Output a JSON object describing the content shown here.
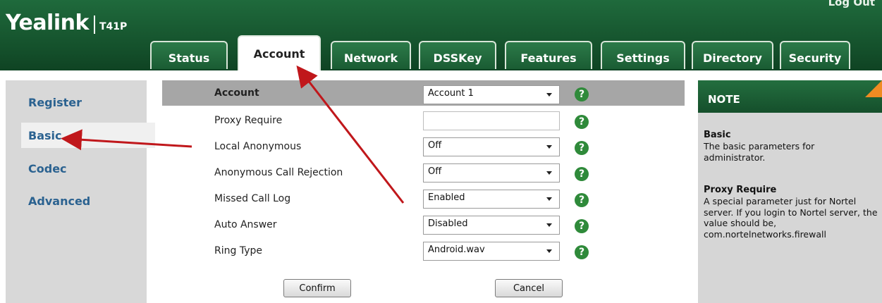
{
  "header": {
    "brand": "Yealink",
    "model": "T41P",
    "logout_label": "Log Out"
  },
  "tabs": [
    {
      "label": "Status"
    },
    {
      "label": "Account"
    },
    {
      "label": "Network"
    },
    {
      "label": "DSSKey"
    },
    {
      "label": "Features"
    },
    {
      "label": "Settings"
    },
    {
      "label": "Directory"
    },
    {
      "label": "Security"
    }
  ],
  "active_tab": "Account",
  "sidebar": {
    "items": [
      {
        "label": "Register"
      },
      {
        "label": "Basic"
      },
      {
        "label": "Codec"
      },
      {
        "label": "Advanced"
      }
    ],
    "selected": "Basic"
  },
  "form": {
    "rows": [
      {
        "label": "Account",
        "type": "select",
        "value": "Account 1"
      },
      {
        "label": "Proxy Require",
        "type": "text",
        "value": ""
      },
      {
        "label": "Local Anonymous",
        "type": "select",
        "value": "Off"
      },
      {
        "label": "Anonymous Call Rejection",
        "type": "select",
        "value": "Off"
      },
      {
        "label": "Missed Call Log",
        "type": "select",
        "value": "Enabled"
      },
      {
        "label": "Auto Answer",
        "type": "select",
        "value": "Disabled"
      },
      {
        "label": "Ring Type",
        "type": "select",
        "value": "Android.wav"
      }
    ],
    "help_glyph": "?",
    "confirm_label": "Confirm",
    "cancel_label": "Cancel"
  },
  "note": {
    "title": "NOTE",
    "sections": [
      {
        "heading": "Basic",
        "text": "The basic parameters for administrator."
      },
      {
        "heading": "Proxy Require",
        "text": "A special parameter just for Nortel server. If you login to Nortel server, the value should be, com.nortelnetworks.firewall"
      }
    ]
  },
  "annotations": {
    "arrow_color": "#c0171b"
  },
  "colors": {
    "header_green": "#1a5c33",
    "nav_link_blue": "#2b6290",
    "help_green": "#2f8a3a",
    "note_corner_orange": "#f08b22"
  }
}
